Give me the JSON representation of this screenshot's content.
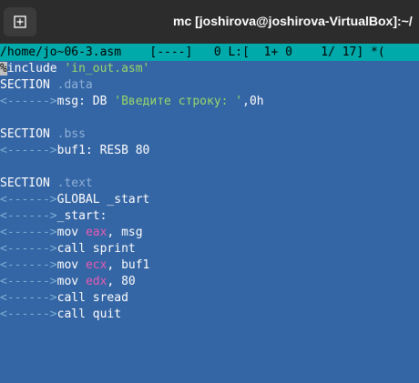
{
  "window": {
    "title": "mc [joshirova@joshirova-VirtualBox]:~/"
  },
  "status": {
    "path": "/home/jo~06-3.asm",
    "flags": "[----]",
    "col": "0",
    "line_label": "L:[",
    "line_pos": "1+ 0",
    "line_count": "1/ 17]",
    "tail": "*("
  },
  "tab_marker": "<------>",
  "code": {
    "l1_cursor": "%",
    "l1_rest": "include",
    "l1_str": "'in_out.asm'",
    "l2_kw": "SECTION",
    "l2_sec": ".data",
    "l3_text": "msg: DB",
    "l3_str": "'Введите строку: '",
    "l3_end": ",0h",
    "l5_kw": "SECTION",
    "l5_sec": ".bss",
    "l6_text": "buf1: RESB 80",
    "l8_kw": "SECTION",
    "l8_sec": ".text",
    "l9_text": "GLOBAL _start",
    "l10_text": "_start:",
    "l11_a": "mov",
    "l11_reg": "eax",
    "l11_b": ", msg",
    "l12_text": "call sprint",
    "l13_a": "mov",
    "l13_reg": "ecx",
    "l13_b": ", buf1",
    "l14_a": "mov",
    "l14_reg": "edx",
    "l14_b": ", 80",
    "l15_text": "call sread",
    "l16_text": "call quit"
  }
}
